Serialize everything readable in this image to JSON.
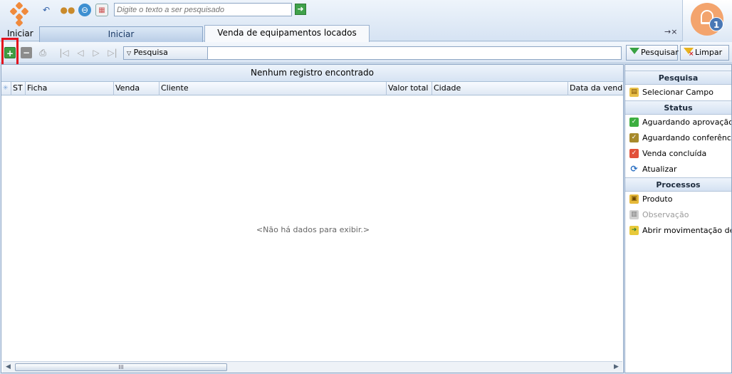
{
  "app": {
    "start_label": "Iniciar",
    "search_placeholder": "Digite o texto a ser pesquisado",
    "notification_count": "1"
  },
  "tabs": [
    {
      "label": "Iniciar"
    },
    {
      "label": "Venda de equipamentos locados"
    }
  ],
  "toolbar": {
    "search_dropdown_label": "Pesquisa",
    "search_button_label": "Pesquisar",
    "clear_button_label": "Limpar"
  },
  "grid": {
    "title": "Nenhum registro encontrado",
    "columns": [
      "ST",
      "Ficha",
      "Venda",
      "Cliente",
      "Valor total",
      "Cidade",
      "Data da venda"
    ],
    "empty_message": "<Não há dados para exibir.>",
    "scroll_thumb_label": "III"
  },
  "side_panel": {
    "sections": [
      {
        "title": "Pesquisa",
        "items": [
          {
            "label": "Selecionar Campo"
          }
        ]
      },
      {
        "title": "Status",
        "items": [
          {
            "label": "Aguardando aprovação"
          },
          {
            "label": "Aguardando conferência"
          },
          {
            "label": "Venda concluída"
          },
          {
            "label": "Atualizar"
          }
        ]
      },
      {
        "title": "Processos",
        "items": [
          {
            "label": "Produto"
          },
          {
            "label": "Observação"
          },
          {
            "label": "Abrir movimentação de..."
          }
        ]
      }
    ]
  },
  "colors": {
    "accent": "#3f9d42",
    "highlight": "#e3101d",
    "bell": "#f3a46d",
    "badge": "#4a78b5"
  }
}
